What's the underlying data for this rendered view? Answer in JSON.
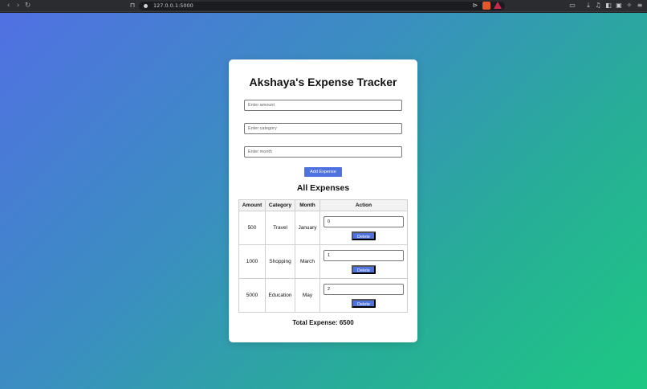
{
  "browser": {
    "url": "127.0.0.1:5000"
  },
  "app": {
    "title": "Akshaya's Expense Tracker",
    "amount_placeholder": "Enter amount",
    "category_placeholder": "Enter category",
    "month_placeholder": "Enter month",
    "add_button": "Add Expense",
    "list_title": "All Expenses",
    "columns": [
      "Amount",
      "Category",
      "Month",
      "Action"
    ],
    "rows": [
      {
        "amount": "500",
        "category": "Travel",
        "month": "January",
        "index": "0",
        "delete": "Delete"
      },
      {
        "amount": "1000",
        "category": "Shopping",
        "month": "March",
        "index": "1",
        "delete": "Delete"
      },
      {
        "amount": "5000",
        "category": "Education",
        "month": "May",
        "index": "2",
        "delete": "Delete"
      }
    ],
    "total": "Total Expense: 6500"
  },
  "colors": {
    "accent": "#4e72e0",
    "gradient_start": "#5170e3",
    "gradient_end": "#1dc882"
  }
}
